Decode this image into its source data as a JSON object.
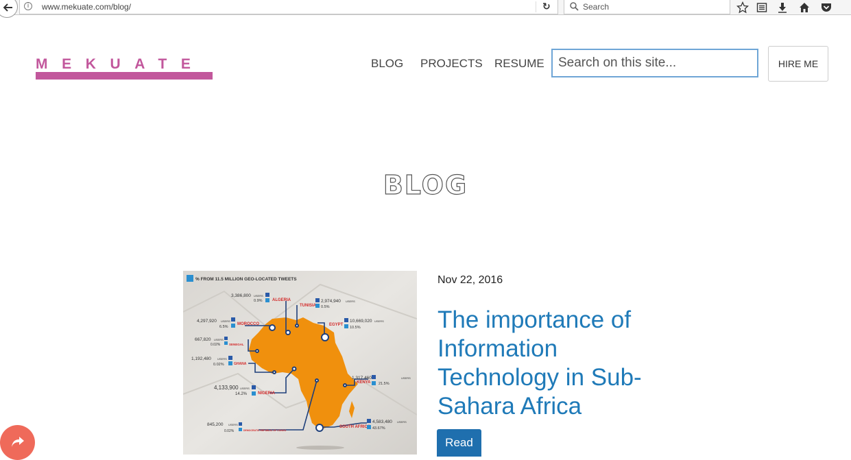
{
  "browser": {
    "url": "www.mekuate.com/blog/",
    "search_placeholder": "Search"
  },
  "site": {
    "logo": "MEKUATE",
    "nav": [
      "BLOG",
      "PROJECTS",
      "RESUME"
    ],
    "search_placeholder": "Search on this site...",
    "hire_label": "HIRE ME",
    "accent_color": "#c2579c"
  },
  "page": {
    "title": "BLOG"
  },
  "post": {
    "date": "Nov 22, 2016",
    "title": "The importance of Information Technology in Sub-Sahara Africa",
    "read_label": "Read",
    "link_color": "#1f7ab8",
    "button_color": "#1f6fae"
  },
  "infographic": {
    "header": "% FROM 11.5 MILLION GEO-LOCATED TWEETS",
    "countries": [
      {
        "name": "ALGERIA",
        "users": "3,386,800",
        "pct": "0.9%"
      },
      {
        "name": "TUNISIA",
        "users": "2,974,940",
        "pct": "0.5%"
      },
      {
        "name": "MOROCCO",
        "users": "4,297,920",
        "pct": "6.5%"
      },
      {
        "name": "EGYPT",
        "users": "10,669,020",
        "pct": "10.5%"
      },
      {
        "name": "SENEGAL",
        "users": "667,820",
        "pct": "0.02%"
      },
      {
        "name": "GHANA",
        "users": "1,192,480",
        "pct": "0.02%"
      },
      {
        "name": "KENYA",
        "users": "1,317,460",
        "pct": "21.5%"
      },
      {
        "name": "NIGERIA",
        "users": "4,133,900",
        "pct": "14.2%"
      },
      {
        "name": "DEMOCRATIC REPUBLIC OF CONGO",
        "users": "845,200",
        "pct": "0.02%"
      },
      {
        "name": "SOUTH AFRICA",
        "users": "4,583,480",
        "pct": "43.67%"
      }
    ],
    "users_word": "USERS"
  }
}
